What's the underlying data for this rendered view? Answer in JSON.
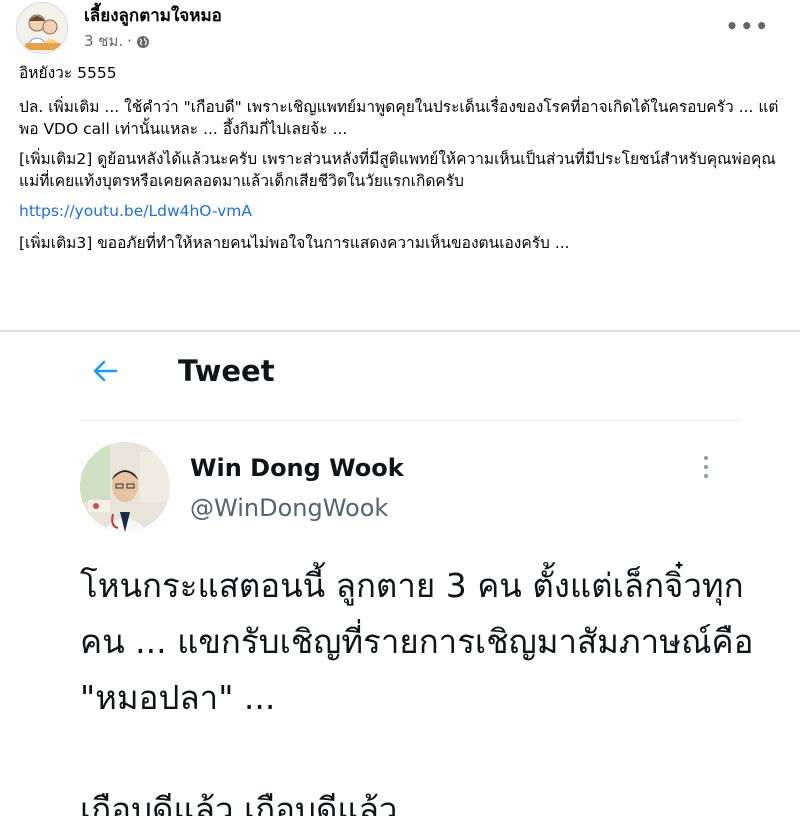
{
  "post": {
    "page_name": "เลี้ยงลูกตามใจหมอ",
    "time": "3 ชม.",
    "separator": "·",
    "more_label": "•••",
    "line1": "อิหยังวะ 5555",
    "paragraph1": "ปล. เพิ่มเติม ... ใช้คำว่า \"เกือบดี\" เพราะเชิญแพทย์มาพูดคุยในประเด็นเรื่องของโรคที่อาจเกิดได้ในครอบครัว ... แต่พอ VDO call เท่านั้นแหละ ... อึ้งกิมกี่ไปเลยจ้ะ ...",
    "paragraph2": "[เพิ่มเติม2] ดูย้อนหลังได้แล้วนะครับ เพราะส่วนหลังที่มีสูติแพทย์ให้ความเห็นเป็นส่วนที่มีประโยชน์สำหรับคุณพ่อคุณแม่ที่เคยแท้งบุตรหรือเคยคลอดมาแล้วเด็กเสียชีวิตในวัยแรกเกิดครับ",
    "link": "https://youtu.be/Ldw4hO-vmA",
    "paragraph3": "[เพิ่มเติม3] ขออภัยที่ทำให้หลายคนไม่พอใจในการแสดงความเห็นของตนเองครับ ..."
  },
  "tweet": {
    "heading": "Tweet",
    "author_name": "Win Dong Wook",
    "author_handle": "@WinDongWook",
    "text1": "โหนกระแสตอนนี้ ลูกตาย 3 คน ตั้งแต่เล็กจิ๋วทุกคน ... แขกรับเชิญที่รายการเชิญมาสัมภาษณ์คือ \"หมอปลา\" ...",
    "text2": "เกือบดีแล้ว เกือบดีแล้ว"
  },
  "colors": {
    "link": "#216fdb",
    "twitter_blue": "#1d9bf0",
    "muted": "#65676b",
    "tweet_handle": "#536471"
  },
  "icons": [
    "globe-icon",
    "more-horizontal-icon",
    "back-arrow-icon",
    "more-vertical-icon"
  ]
}
